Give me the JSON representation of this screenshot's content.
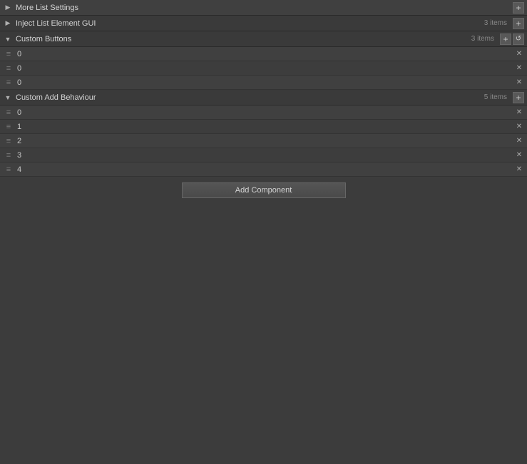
{
  "sections": [
    {
      "id": "more-list-settings",
      "label": "More List Settings",
      "collapsed": true,
      "show_count": false,
      "count": null,
      "has_add": true,
      "has_refresh": false,
      "items": []
    },
    {
      "id": "inject-list-element-gui",
      "label": "Inject List Element GUI",
      "collapsed": true,
      "show_count": true,
      "count": "3 items",
      "has_add": true,
      "has_refresh": false,
      "items": []
    },
    {
      "id": "custom-buttons",
      "label": "Custom Buttons",
      "collapsed": false,
      "show_count": true,
      "count": "3 items",
      "has_add": true,
      "has_refresh": true,
      "items": [
        {
          "value": "0"
        },
        {
          "value": "0"
        },
        {
          "value": "0"
        }
      ]
    },
    {
      "id": "custom-add-behaviour",
      "label": "Custom Add Behaviour",
      "collapsed": false,
      "show_count": true,
      "count": "5 items",
      "has_add": true,
      "has_refresh": false,
      "items": [
        {
          "value": "0"
        },
        {
          "value": "1"
        },
        {
          "value": "2"
        },
        {
          "value": "3"
        },
        {
          "value": "4"
        }
      ]
    }
  ],
  "add_component_label": "Add Component",
  "icons": {
    "collapsed": "▶",
    "expanded": "▼",
    "drag": "≡",
    "add": "+",
    "refresh": "↺",
    "close": "✕"
  }
}
